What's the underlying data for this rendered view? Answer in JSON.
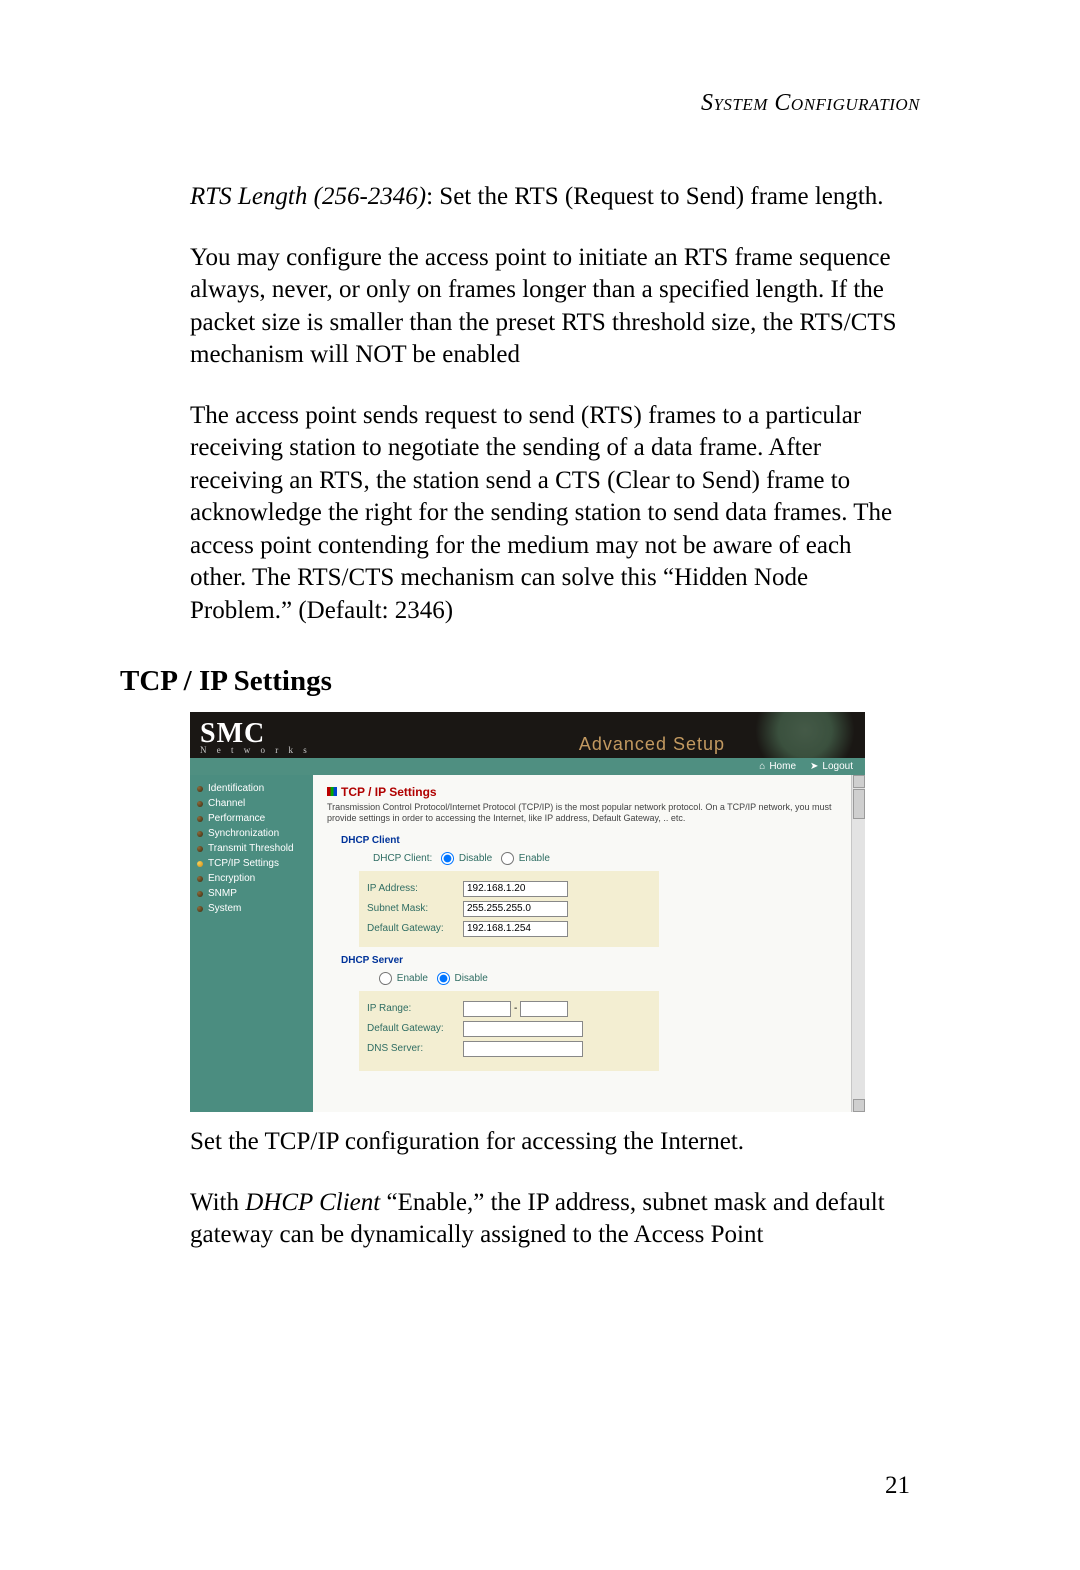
{
  "doc": {
    "system_heading": "System Configuration",
    "para1_label": "RTS Length (256-2346)",
    "para1_rest": ": Set the RTS (Request to Send) frame length.",
    "para2": "You may configure the access point to initiate an RTS frame sequence always, never, or only on frames longer than a specified length. If the packet size is smaller than the preset RTS threshold size, the RTS/CTS mechanism will NOT be enabled",
    "para3": "The access point sends request to send (RTS) frames to a particular receiving station to negotiate the sending of a data frame. After receiving an RTS, the station send a CTS (Clear to Send) frame to acknowledge the right for the sending station to send data frames. The access point contending for the medium may not be aware of each other. The RTS/CTS mechanism can solve this “Hidden Node Problem.” (Default: 2346)",
    "section_heading": "TCP / IP Settings",
    "after_shot_1": "Set the TCP/IP configuration for accessing the Internet.",
    "after_shot_2a": "With ",
    "after_shot_2b_italic": "DHCP Client",
    "after_shot_2c": " “Enable,” the IP address, subnet mask and default gateway can be dynamically assigned to the Access Point",
    "page_number": "21"
  },
  "shot": {
    "logo_big": "SMC",
    "logo_small": "N e t w o r k s",
    "adv": "Advanced Setup",
    "home": "Home",
    "logout": "Logout",
    "sidebar": [
      "Identification",
      "Channel",
      "Performance",
      "Synchronization",
      "Transmit Threshold",
      "TCP/IP Settings",
      "Encryption",
      "SNMP",
      "System"
    ],
    "active_index": 5,
    "title": "TCP / IP Settings",
    "desc": "Transmission Control Protocol/Internet Protocol (TCP/IP) is the most popular network protocol. On a TCP/IP network, you must provide settings in order to accessing the Internet, like IP address, Default Gateway, .. etc.",
    "dhcp_client_title": "DHCP Client",
    "dhcp_client_label": "DHCP Client:",
    "disable": "Disable",
    "enable": "Enable",
    "ip_address_lbl": "IP Address:",
    "ip_address_val": "192.168.1.20",
    "subnet_lbl": "Subnet Mask:",
    "subnet_val": "255.255.255.0",
    "gateway_lbl": "Default Gateway:",
    "gateway_val": "192.168.1.254",
    "dhcp_server_title": "DHCP Server",
    "ip_range_lbl": "IP Range:",
    "dg2_lbl": "Default Gateway:",
    "dns_lbl": "DNS Server:",
    "dash": "-"
  }
}
